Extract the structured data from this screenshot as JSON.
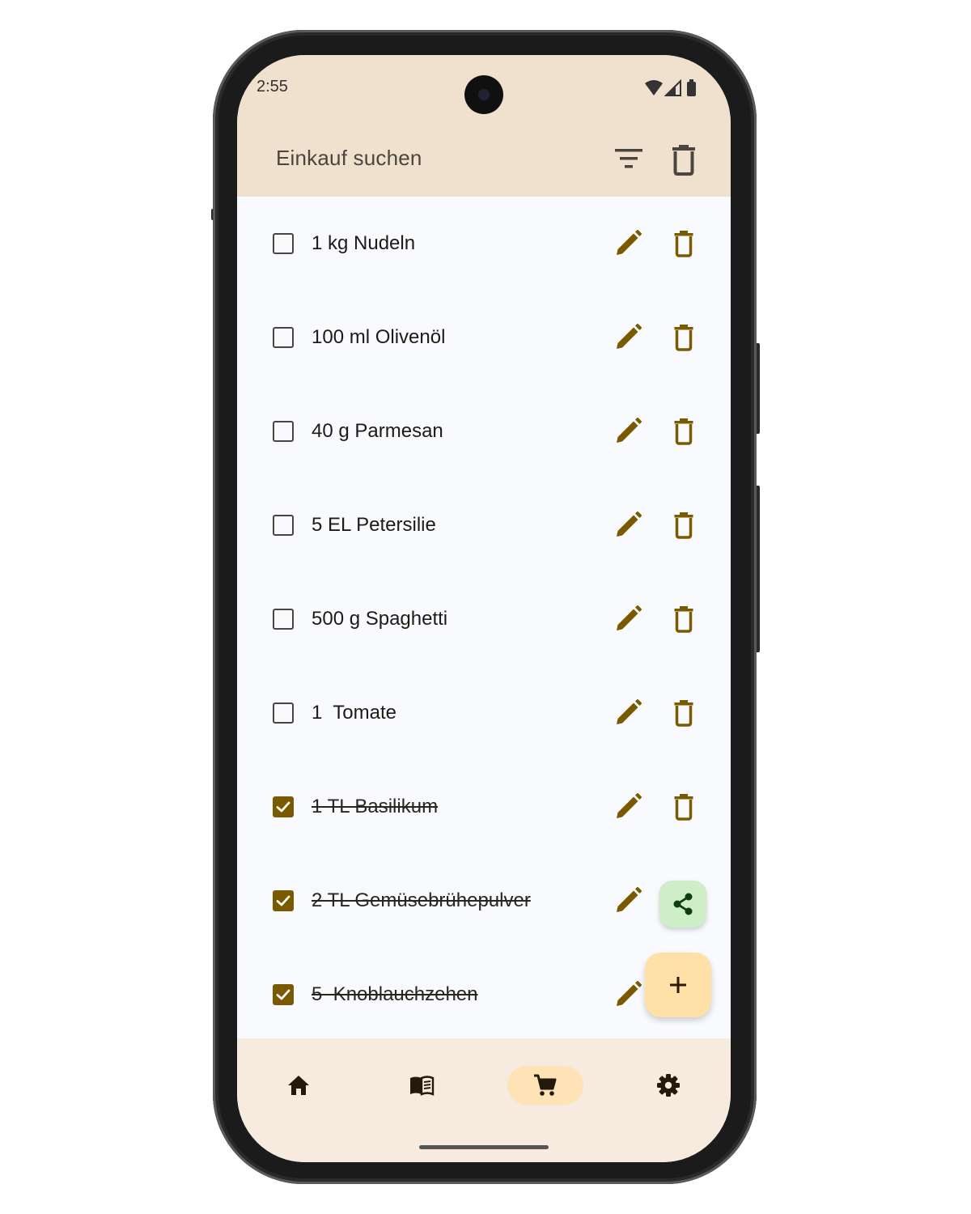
{
  "status_bar": {
    "time": "2:55"
  },
  "search": {
    "placeholder": "Einkauf suchen"
  },
  "items": [
    {
      "label": "1 kg Nudeln",
      "checked": false
    },
    {
      "label": "100 ml Olivenöl",
      "checked": false
    },
    {
      "label": "40 g Parmesan",
      "checked": false
    },
    {
      "label": "5 EL Petersilie",
      "checked": false
    },
    {
      "label": "500 g Spaghetti",
      "checked": false
    },
    {
      "label": "1  Tomate",
      "checked": false
    },
    {
      "label": "1 TL Basilikum",
      "checked": true
    },
    {
      "label": "2 TL Gemüsebrühepulver",
      "checked": true
    },
    {
      "label": "5  Knoblauchzehen",
      "checked": true
    }
  ],
  "colors": {
    "accent": "#7a5a00",
    "top_bar": "#efe1cd",
    "bottom_nav": "#f6ebde",
    "fab_add": "#ffe0a6",
    "fab_share": "#cdeec6",
    "nav_selected": "#fde3b6"
  },
  "icons": {
    "filter": "filter-icon",
    "delete": "trash-icon",
    "edit": "pencil-icon",
    "share": "share-icon",
    "add": "plus-icon",
    "nav": [
      "home-icon",
      "book-icon",
      "cart-icon",
      "gear-icon"
    ]
  },
  "nav": {
    "selected": "shopping"
  }
}
